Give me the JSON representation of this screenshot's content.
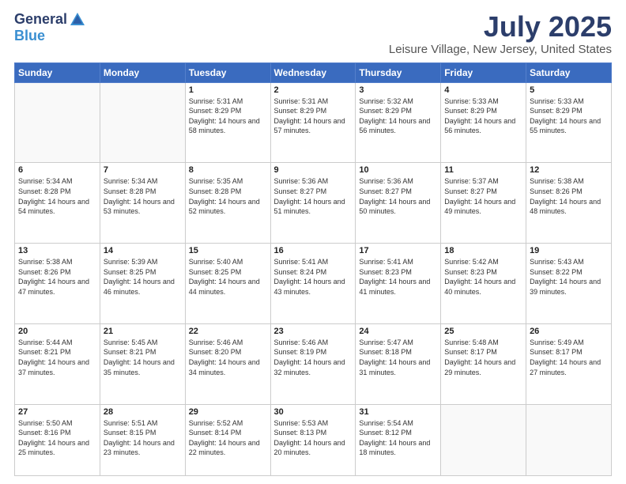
{
  "header": {
    "logo_general": "General",
    "logo_blue": "Blue",
    "title": "July 2025",
    "location": "Leisure Village, New Jersey, United States"
  },
  "weekdays": [
    "Sunday",
    "Monday",
    "Tuesday",
    "Wednesday",
    "Thursday",
    "Friday",
    "Saturday"
  ],
  "weeks": [
    [
      {
        "day": "",
        "sunrise": "",
        "sunset": "",
        "daylight": ""
      },
      {
        "day": "",
        "sunrise": "",
        "sunset": "",
        "daylight": ""
      },
      {
        "day": "1",
        "sunrise": "Sunrise: 5:31 AM",
        "sunset": "Sunset: 8:29 PM",
        "daylight": "Daylight: 14 hours and 58 minutes."
      },
      {
        "day": "2",
        "sunrise": "Sunrise: 5:31 AM",
        "sunset": "Sunset: 8:29 PM",
        "daylight": "Daylight: 14 hours and 57 minutes."
      },
      {
        "day": "3",
        "sunrise": "Sunrise: 5:32 AM",
        "sunset": "Sunset: 8:29 PM",
        "daylight": "Daylight: 14 hours and 56 minutes."
      },
      {
        "day": "4",
        "sunrise": "Sunrise: 5:33 AM",
        "sunset": "Sunset: 8:29 PM",
        "daylight": "Daylight: 14 hours and 56 minutes."
      },
      {
        "day": "5",
        "sunrise": "Sunrise: 5:33 AM",
        "sunset": "Sunset: 8:29 PM",
        "daylight": "Daylight: 14 hours and 55 minutes."
      }
    ],
    [
      {
        "day": "6",
        "sunrise": "Sunrise: 5:34 AM",
        "sunset": "Sunset: 8:28 PM",
        "daylight": "Daylight: 14 hours and 54 minutes."
      },
      {
        "day": "7",
        "sunrise": "Sunrise: 5:34 AM",
        "sunset": "Sunset: 8:28 PM",
        "daylight": "Daylight: 14 hours and 53 minutes."
      },
      {
        "day": "8",
        "sunrise": "Sunrise: 5:35 AM",
        "sunset": "Sunset: 8:28 PM",
        "daylight": "Daylight: 14 hours and 52 minutes."
      },
      {
        "day": "9",
        "sunrise": "Sunrise: 5:36 AM",
        "sunset": "Sunset: 8:27 PM",
        "daylight": "Daylight: 14 hours and 51 minutes."
      },
      {
        "day": "10",
        "sunrise": "Sunrise: 5:36 AM",
        "sunset": "Sunset: 8:27 PM",
        "daylight": "Daylight: 14 hours and 50 minutes."
      },
      {
        "day": "11",
        "sunrise": "Sunrise: 5:37 AM",
        "sunset": "Sunset: 8:27 PM",
        "daylight": "Daylight: 14 hours and 49 minutes."
      },
      {
        "day": "12",
        "sunrise": "Sunrise: 5:38 AM",
        "sunset": "Sunset: 8:26 PM",
        "daylight": "Daylight: 14 hours and 48 minutes."
      }
    ],
    [
      {
        "day": "13",
        "sunrise": "Sunrise: 5:38 AM",
        "sunset": "Sunset: 8:26 PM",
        "daylight": "Daylight: 14 hours and 47 minutes."
      },
      {
        "day": "14",
        "sunrise": "Sunrise: 5:39 AM",
        "sunset": "Sunset: 8:25 PM",
        "daylight": "Daylight: 14 hours and 46 minutes."
      },
      {
        "day": "15",
        "sunrise": "Sunrise: 5:40 AM",
        "sunset": "Sunset: 8:25 PM",
        "daylight": "Daylight: 14 hours and 44 minutes."
      },
      {
        "day": "16",
        "sunrise": "Sunrise: 5:41 AM",
        "sunset": "Sunset: 8:24 PM",
        "daylight": "Daylight: 14 hours and 43 minutes."
      },
      {
        "day": "17",
        "sunrise": "Sunrise: 5:41 AM",
        "sunset": "Sunset: 8:23 PM",
        "daylight": "Daylight: 14 hours and 41 minutes."
      },
      {
        "day": "18",
        "sunrise": "Sunrise: 5:42 AM",
        "sunset": "Sunset: 8:23 PM",
        "daylight": "Daylight: 14 hours and 40 minutes."
      },
      {
        "day": "19",
        "sunrise": "Sunrise: 5:43 AM",
        "sunset": "Sunset: 8:22 PM",
        "daylight": "Daylight: 14 hours and 39 minutes."
      }
    ],
    [
      {
        "day": "20",
        "sunrise": "Sunrise: 5:44 AM",
        "sunset": "Sunset: 8:21 PM",
        "daylight": "Daylight: 14 hours and 37 minutes."
      },
      {
        "day": "21",
        "sunrise": "Sunrise: 5:45 AM",
        "sunset": "Sunset: 8:21 PM",
        "daylight": "Daylight: 14 hours and 35 minutes."
      },
      {
        "day": "22",
        "sunrise": "Sunrise: 5:46 AM",
        "sunset": "Sunset: 8:20 PM",
        "daylight": "Daylight: 14 hours and 34 minutes."
      },
      {
        "day": "23",
        "sunrise": "Sunrise: 5:46 AM",
        "sunset": "Sunset: 8:19 PM",
        "daylight": "Daylight: 14 hours and 32 minutes."
      },
      {
        "day": "24",
        "sunrise": "Sunrise: 5:47 AM",
        "sunset": "Sunset: 8:18 PM",
        "daylight": "Daylight: 14 hours and 31 minutes."
      },
      {
        "day": "25",
        "sunrise": "Sunrise: 5:48 AM",
        "sunset": "Sunset: 8:17 PM",
        "daylight": "Daylight: 14 hours and 29 minutes."
      },
      {
        "day": "26",
        "sunrise": "Sunrise: 5:49 AM",
        "sunset": "Sunset: 8:17 PM",
        "daylight": "Daylight: 14 hours and 27 minutes."
      }
    ],
    [
      {
        "day": "27",
        "sunrise": "Sunrise: 5:50 AM",
        "sunset": "Sunset: 8:16 PM",
        "daylight": "Daylight: 14 hours and 25 minutes."
      },
      {
        "day": "28",
        "sunrise": "Sunrise: 5:51 AM",
        "sunset": "Sunset: 8:15 PM",
        "daylight": "Daylight: 14 hours and 23 minutes."
      },
      {
        "day": "29",
        "sunrise": "Sunrise: 5:52 AM",
        "sunset": "Sunset: 8:14 PM",
        "daylight": "Daylight: 14 hours and 22 minutes."
      },
      {
        "day": "30",
        "sunrise": "Sunrise: 5:53 AM",
        "sunset": "Sunset: 8:13 PM",
        "daylight": "Daylight: 14 hours and 20 minutes."
      },
      {
        "day": "31",
        "sunrise": "Sunrise: 5:54 AM",
        "sunset": "Sunset: 8:12 PM",
        "daylight": "Daylight: 14 hours and 18 minutes."
      },
      {
        "day": "",
        "sunrise": "",
        "sunset": "",
        "daylight": ""
      },
      {
        "day": "",
        "sunrise": "",
        "sunset": "",
        "daylight": ""
      }
    ]
  ]
}
